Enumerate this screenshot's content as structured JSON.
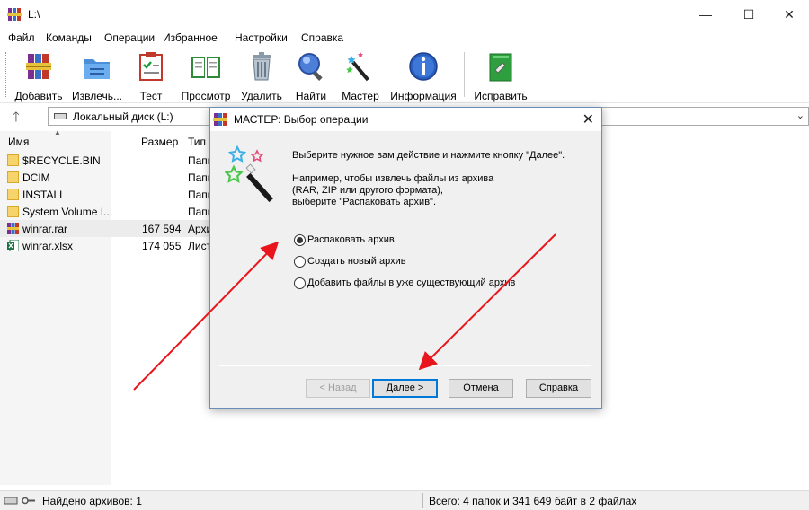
{
  "window": {
    "title": "L:\\",
    "minimize": "—",
    "maximize": "☐",
    "close": "✕"
  },
  "menu": [
    "Файл",
    "Команды",
    "Операции",
    "Избранное",
    "Настройки",
    "Справка"
  ],
  "toolbar": [
    {
      "label": "Добавить",
      "icon": "add-archive-icon"
    },
    {
      "label": "Извлечь...",
      "icon": "extract-icon"
    },
    {
      "label": "Тест",
      "icon": "test-icon"
    },
    {
      "label": "Просмотр",
      "icon": "view-icon"
    },
    {
      "label": "Удалить",
      "icon": "delete-icon"
    },
    {
      "label": "Найти",
      "icon": "find-icon"
    },
    {
      "label": "Мастер",
      "icon": "wizard-icon"
    },
    {
      "label": "Информация",
      "icon": "info-icon"
    },
    {
      "label": "Исправить",
      "icon": "repair-icon"
    }
  ],
  "address": {
    "up": "🡑",
    "path": "Локальный диск (L:)",
    "dropdown": "⌄"
  },
  "columns": {
    "name": "Имя",
    "size": "Размер",
    "type": "Тип"
  },
  "files": [
    {
      "name": "$RECYCLE.BIN",
      "size": "",
      "type": "Папка",
      "kind": "folder"
    },
    {
      "name": "DCIM",
      "size": "",
      "type": "Папка",
      "kind": "folder"
    },
    {
      "name": "INSTALL",
      "size": "",
      "type": "Папка",
      "kind": "folder"
    },
    {
      "name": "System Volume I...",
      "size": "",
      "type": "Папка",
      "kind": "folder"
    },
    {
      "name": "winrar.rar",
      "size": "167 594",
      "type": "Архив",
      "kind": "rar"
    },
    {
      "name": "winrar.xlsx",
      "size": "174 055",
      "type": "Лист",
      "kind": "xlsx"
    }
  ],
  "status": {
    "left": "Найдено архивов: 1",
    "right": "Всего: 4 папок и 341 649 байт в 2 файлах"
  },
  "dialog": {
    "title": "МАСТЕР:  Выбор операции",
    "close": "✕",
    "intro": "Выберите нужное вам действие и нажмите кнопку \"Далее\".",
    "hint_lines": [
      "Например, чтобы извлечь файлы из архива",
      "(RAR, ZIP или другого формата),",
      "выберите \"Распаковать архив\"."
    ],
    "options": [
      {
        "label": "Распаковать архив",
        "checked": true
      },
      {
        "label": "Создать новый архив",
        "checked": false
      },
      {
        "label": "Добавить файлы в уже существующий архив",
        "checked": false
      }
    ],
    "buttons": {
      "back": "< Назад",
      "next": "Далее >",
      "cancel": "Отмена",
      "help": "Справка"
    }
  },
  "colors": {
    "arrow": "#e8161c",
    "accent": "#0078d7"
  }
}
